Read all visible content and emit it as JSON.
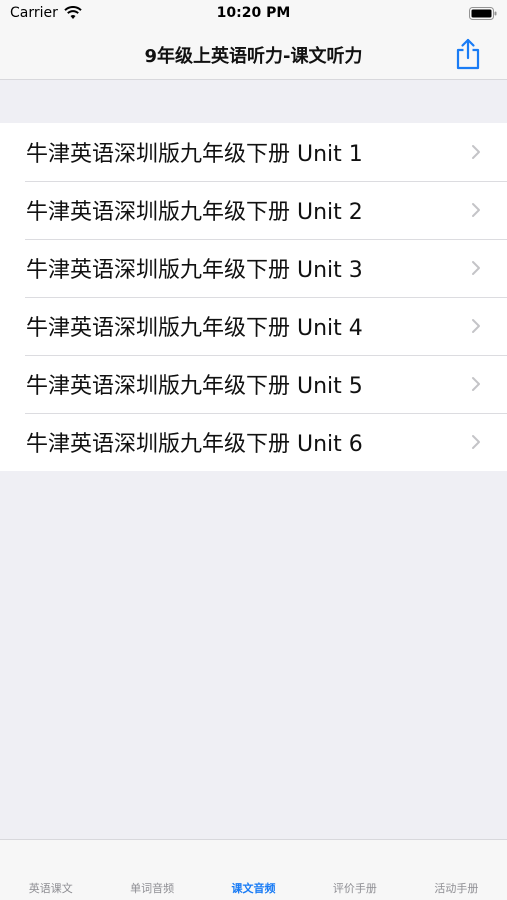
{
  "status_bar": {
    "carrier": "Carrier",
    "time": "10:20 PM"
  },
  "nav": {
    "title": "9年级上英语听力-课文听力",
    "share_icon": "share-icon",
    "accent": "#1a7cf5"
  },
  "list": {
    "items": [
      {
        "label": "牛津英语深圳版九年级下册 Unit 1"
      },
      {
        "label": "牛津英语深圳版九年级下册 Unit 2"
      },
      {
        "label": "牛津英语深圳版九年级下册 Unit 3"
      },
      {
        "label": "牛津英语深圳版九年级下册 Unit 4"
      },
      {
        "label": "牛津英语深圳版九年级下册 Unit 5"
      },
      {
        "label": "牛津英语深圳版九年级下册 Unit 6"
      }
    ]
  },
  "tabs": {
    "items": [
      {
        "label": "英语课文"
      },
      {
        "label": "单词音频"
      },
      {
        "label": "课文音频"
      },
      {
        "label": "评价手册"
      },
      {
        "label": "活动手册"
      }
    ],
    "selected": "课文音频",
    "selected_color": "#1a7cf5",
    "inactive_color": "#8e8e93"
  }
}
